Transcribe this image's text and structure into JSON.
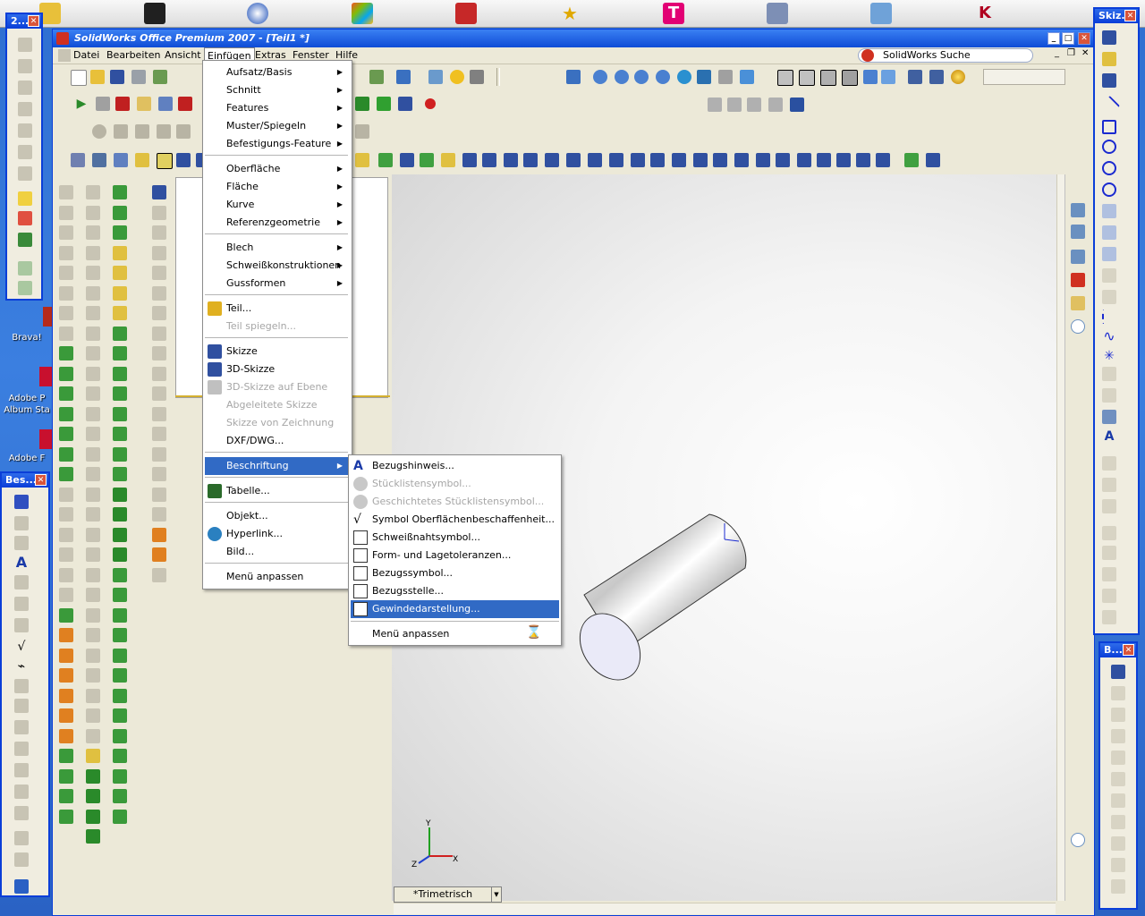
{
  "window": {
    "title": "SolidWorks Office Premium 2007 - [Teil1 *]",
    "search_label": "SolidWorks Suche"
  },
  "menubar": [
    "Datei",
    "Bearbeiten",
    "Ansicht",
    "Einfügen",
    "Extras",
    "Fenster",
    "Hilfe"
  ],
  "einfuegen_menu": {
    "items": [
      {
        "label": "Aufsatz/Basis",
        "submenu": true,
        "disabled": false
      },
      {
        "label": "Schnitt",
        "submenu": true,
        "disabled": false
      },
      {
        "label": "Features",
        "submenu": true,
        "disabled": false
      },
      {
        "label": "Muster/Spiegeln",
        "submenu": true,
        "disabled": false
      },
      {
        "label": "Befestigungs-Feature",
        "submenu": true,
        "disabled": false
      },
      {
        "label": "Oberfläche",
        "submenu": true,
        "disabled": false
      },
      {
        "label": "Fläche",
        "submenu": true,
        "disabled": false
      },
      {
        "label": "Kurve",
        "submenu": true,
        "disabled": false
      },
      {
        "label": "Referenzgeometrie",
        "submenu": true,
        "disabled": false
      },
      {
        "label": "Blech",
        "submenu": true,
        "disabled": false
      },
      {
        "label": "Schweißkonstruktionen",
        "submenu": true,
        "disabled": false
      },
      {
        "label": "Gussformen",
        "submenu": true,
        "disabled": false
      },
      {
        "label": "Teil...",
        "submenu": false,
        "disabled": false
      },
      {
        "label": "Teil spiegeln...",
        "submenu": false,
        "disabled": true
      },
      {
        "label": "Skizze",
        "submenu": false,
        "disabled": false
      },
      {
        "label": "3D-Skizze",
        "submenu": false,
        "disabled": false
      },
      {
        "label": "3D-Skizze auf Ebene",
        "submenu": false,
        "disabled": true
      },
      {
        "label": "Abgeleitete Skizze",
        "submenu": false,
        "disabled": true
      },
      {
        "label": "Skizze von Zeichnung",
        "submenu": false,
        "disabled": true
      },
      {
        "label": "DXF/DWG...",
        "submenu": false,
        "disabled": false
      },
      {
        "label": "Beschriftung",
        "submenu": true,
        "disabled": false,
        "highlighted": true
      },
      {
        "label": "Tabelle...",
        "submenu": false,
        "disabled": false
      },
      {
        "label": "Objekt...",
        "submenu": false,
        "disabled": false
      },
      {
        "label": "Hyperlink...",
        "submenu": false,
        "disabled": false
      },
      {
        "label": "Bild...",
        "submenu": false,
        "disabled": false
      },
      {
        "label": "Menü anpassen",
        "submenu": false,
        "disabled": false
      }
    ]
  },
  "beschriftung_menu": {
    "items": [
      {
        "label": "Bezugshinweis...",
        "disabled": false
      },
      {
        "label": "Stücklistensymbol...",
        "disabled": true
      },
      {
        "label": "Geschichtetes Stücklistensymbol...",
        "disabled": true
      },
      {
        "label": "Symbol Oberflächenbeschaffenheit...",
        "disabled": false
      },
      {
        "label": "Schweißnahtsymbol...",
        "disabled": false
      },
      {
        "label": "Form- und Lagetoleranzen...",
        "disabled": false
      },
      {
        "label": "Bezugssymbol...",
        "disabled": false
      },
      {
        "label": "Bezugsstelle...",
        "disabled": false
      },
      {
        "label": "Gewindedarstellung...",
        "disabled": false,
        "highlighted": true
      },
      {
        "label": "Menü anpassen",
        "disabled": false
      }
    ]
  },
  "palettes": {
    "left_top": "2...",
    "left_bottom": "Bes...",
    "right_top": "Skiz...",
    "right_bottom": "B..."
  },
  "desktop_labels": [
    "Brava!",
    "Adobe P",
    "Album Sta",
    "Adobe F"
  ],
  "viewport": {
    "view_name": "*Trimetrisch",
    "axes": {
      "x": "X",
      "y": "Y",
      "z": "Z"
    }
  },
  "colors": {
    "title_blue": "#0f4cd6",
    "highlight": "#316ac5",
    "menu_bg": "#ffffff",
    "chrome": "#ece9d8"
  }
}
